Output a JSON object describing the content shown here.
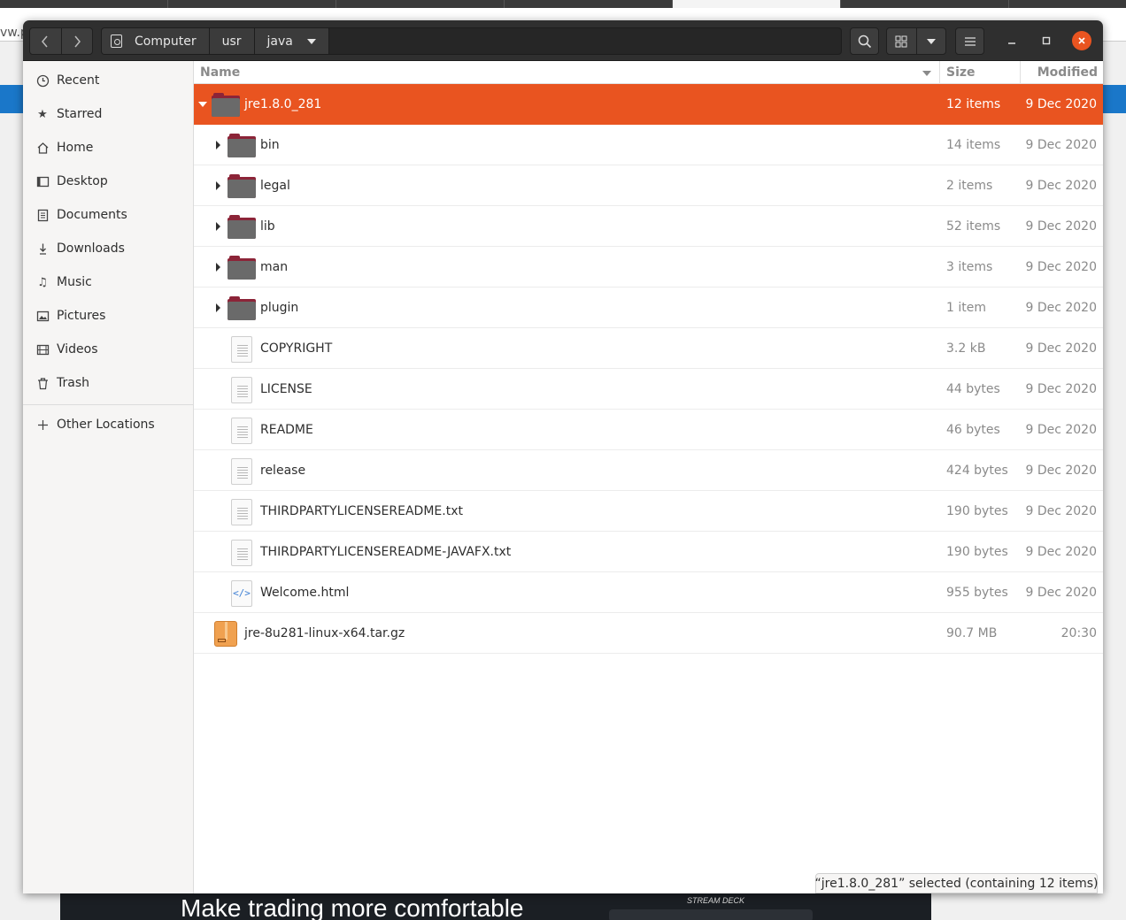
{
  "background": {
    "url_fragment": "vw.p",
    "ad_text": "Make trading more comfortable",
    "ad_brand": "STREAM DECK"
  },
  "headerbar": {
    "back_icon": "chevron-left-icon",
    "forward_icon": "chevron-right-icon",
    "path": [
      "Computer",
      "usr",
      "java"
    ],
    "search_icon": "search-icon",
    "view_icon": "grid-icon",
    "menu_icon": "hamburger-icon",
    "accent_color": "#e95420"
  },
  "sidebar": {
    "items": [
      {
        "label": "Recent",
        "icon": "clock-icon"
      },
      {
        "label": "Starred",
        "icon": "star-icon"
      },
      {
        "label": "Home",
        "icon": "home-icon"
      },
      {
        "label": "Desktop",
        "icon": "desktop-icon"
      },
      {
        "label": "Documents",
        "icon": "document-icon"
      },
      {
        "label": "Downloads",
        "icon": "download-icon"
      },
      {
        "label": "Music",
        "icon": "music-icon"
      },
      {
        "label": "Pictures",
        "icon": "picture-icon"
      },
      {
        "label": "Videos",
        "icon": "film-icon"
      },
      {
        "label": "Trash",
        "icon": "trash-icon"
      }
    ],
    "other_locations": "Other Locations"
  },
  "columns": {
    "name": "Name",
    "size": "Size",
    "modified": "Modified"
  },
  "files": [
    {
      "name": "jre1.8.0_281",
      "size": "12 items",
      "modified": "9 Dec 2020",
      "type": "folder",
      "expanded": true,
      "selected": true,
      "depth": 0
    },
    {
      "name": "bin",
      "size": "14 items",
      "modified": "9 Dec 2020",
      "type": "folder",
      "expanded": false,
      "selected": false,
      "depth": 1
    },
    {
      "name": "legal",
      "size": "2 items",
      "modified": "9 Dec 2020",
      "type": "folder",
      "expanded": false,
      "selected": false,
      "depth": 1
    },
    {
      "name": "lib",
      "size": "52 items",
      "modified": "9 Dec 2020",
      "type": "folder",
      "expanded": false,
      "selected": false,
      "depth": 1
    },
    {
      "name": "man",
      "size": "3 items",
      "modified": "9 Dec 2020",
      "type": "folder",
      "expanded": false,
      "selected": false,
      "depth": 1
    },
    {
      "name": "plugin",
      "size": "1 item",
      "modified": "9 Dec 2020",
      "type": "folder",
      "expanded": false,
      "selected": false,
      "depth": 1
    },
    {
      "name": "COPYRIGHT",
      "size": "3.2 kB",
      "modified": "9 Dec 2020",
      "type": "text",
      "selected": false,
      "depth": 1
    },
    {
      "name": "LICENSE",
      "size": "44 bytes",
      "modified": "9 Dec 2020",
      "type": "text",
      "selected": false,
      "depth": 1
    },
    {
      "name": "README",
      "size": "46 bytes",
      "modified": "9 Dec 2020",
      "type": "text",
      "selected": false,
      "depth": 1
    },
    {
      "name": "release",
      "size": "424 bytes",
      "modified": "9 Dec 2020",
      "type": "text",
      "selected": false,
      "depth": 1
    },
    {
      "name": "THIRDPARTYLICENSEREADME.txt",
      "size": "190 bytes",
      "modified": "9 Dec 2020",
      "type": "text",
      "selected": false,
      "depth": 1
    },
    {
      "name": "THIRDPARTYLICENSEREADME-JAVAFX.txt",
      "size": "190 bytes",
      "modified": "9 Dec 2020",
      "type": "text",
      "selected": false,
      "depth": 1
    },
    {
      "name": "Welcome.html",
      "size": "955 bytes",
      "modified": "9 Dec 2020",
      "type": "html",
      "selected": false,
      "depth": 1
    },
    {
      "name": "jre-8u281-linux-x64.tar.gz",
      "size": "90.7 MB",
      "modified": "20:30",
      "type": "archive",
      "selected": false,
      "depth": 0
    }
  ],
  "status": "“jre1.8.0_281” selected  (containing 12 items)"
}
